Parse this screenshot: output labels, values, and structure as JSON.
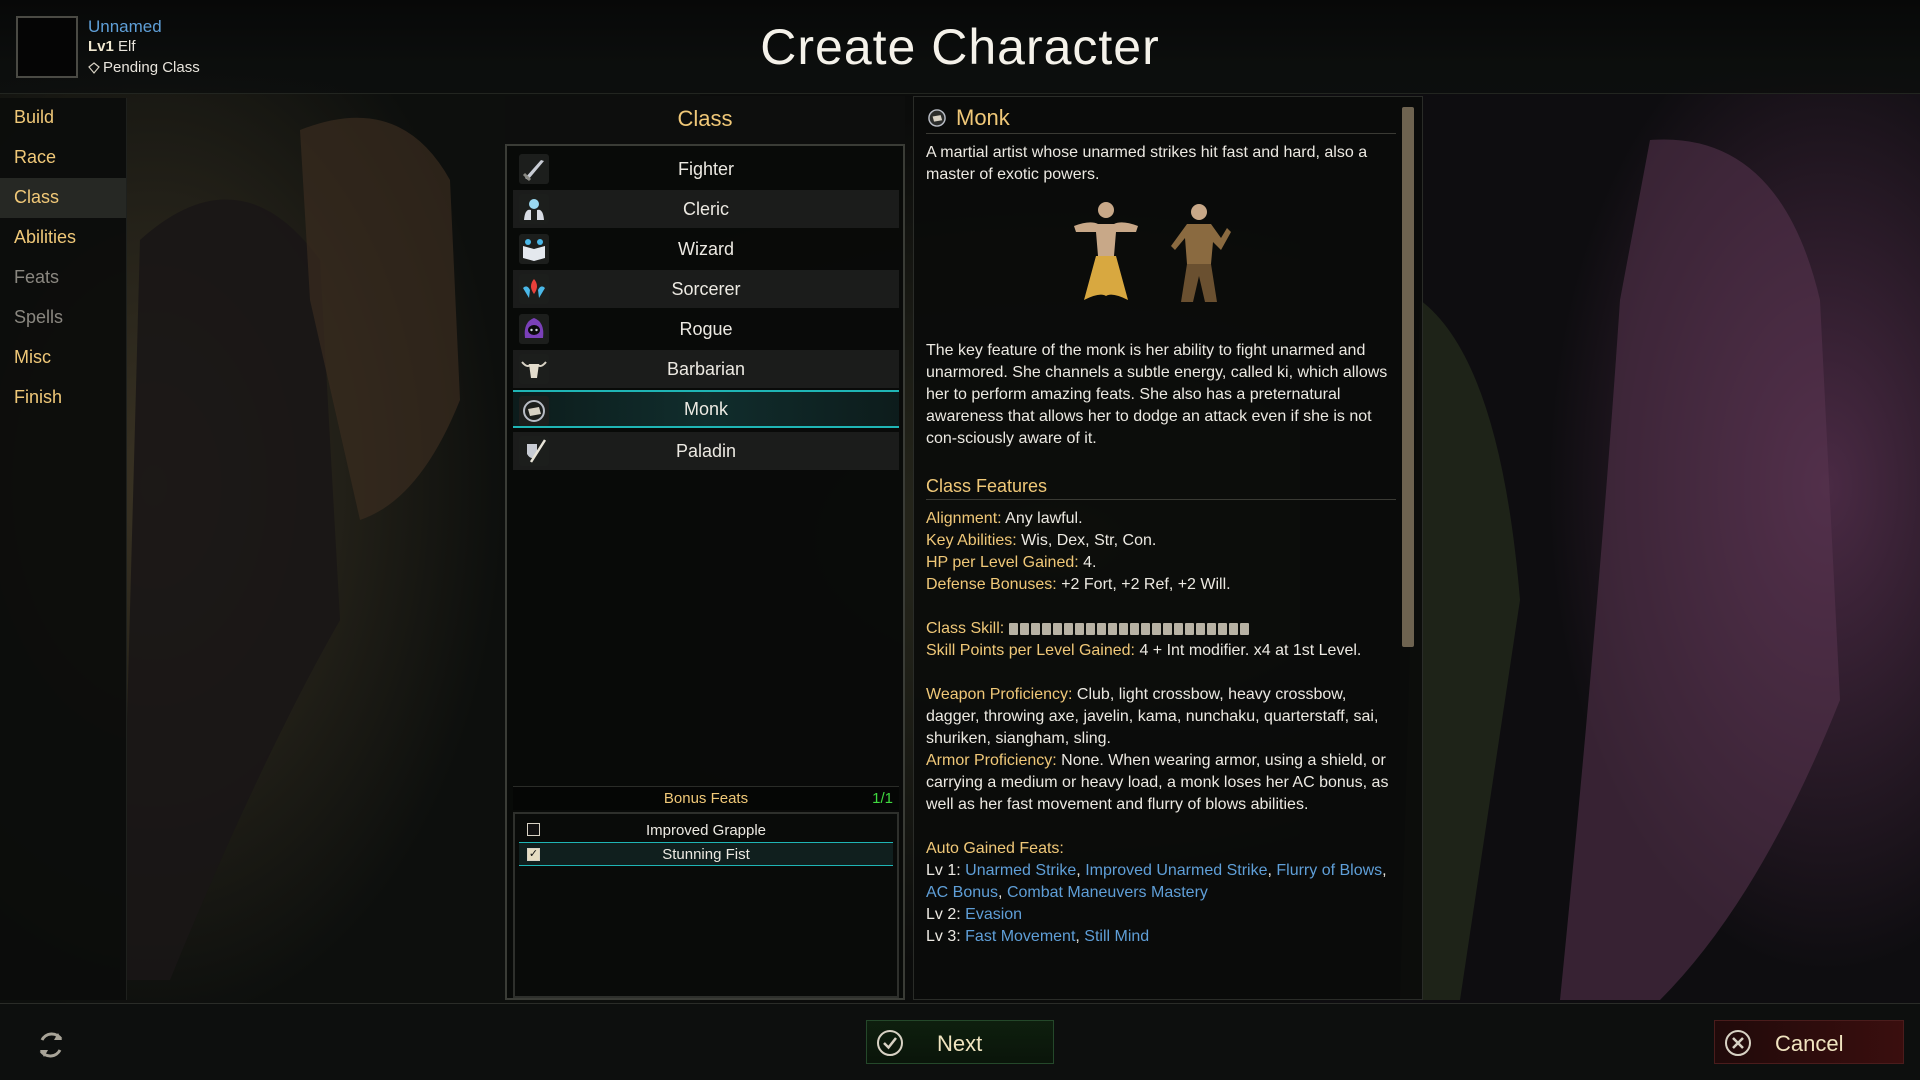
{
  "window": {
    "title": "Create Character"
  },
  "character": {
    "name": "Unnamed",
    "level_prefix": "Lv1",
    "race": "Elf",
    "class_status": "Pending Class"
  },
  "sidebar": {
    "items": [
      {
        "label": "Build",
        "state": "normal"
      },
      {
        "label": "Race",
        "state": "normal"
      },
      {
        "label": "Class",
        "state": "active"
      },
      {
        "label": "Abilities",
        "state": "normal"
      },
      {
        "label": "Feats",
        "state": "disabled"
      },
      {
        "label": "Spells",
        "state": "disabled"
      },
      {
        "label": "Misc",
        "state": "normal"
      },
      {
        "label": "Finish",
        "state": "normal"
      }
    ]
  },
  "class_panel": {
    "title": "Class",
    "classes": [
      {
        "label": "Fighter",
        "icon": "sword-icon"
      },
      {
        "label": "Cleric",
        "icon": "holy-hands-icon"
      },
      {
        "label": "Wizard",
        "icon": "spellbook-icon"
      },
      {
        "label": "Sorcerer",
        "icon": "flame-hands-icon"
      },
      {
        "label": "Rogue",
        "icon": "hood-icon"
      },
      {
        "label": "Barbarian",
        "icon": "bull-skull-icon"
      },
      {
        "label": "Monk",
        "icon": "fist-icon",
        "selected": true
      },
      {
        "label": "Paladin",
        "icon": "shield-sword-icon"
      }
    ],
    "bonus_feats": {
      "title": "Bonus Feats",
      "count": "1/1",
      "items": [
        {
          "label": "Improved Grapple",
          "checked": false
        },
        {
          "label": "Stunning Fist",
          "checked": true
        }
      ]
    }
  },
  "description": {
    "title": "Monk",
    "summary": "A martial artist whose unarmed strikes hit fast and hard, also a master of exotic powers.",
    "body": "The key feature of the monk is her ability to fight unarmed and unarmored. She channels a subtle energy, called ki, which allows her to perform amazing feats. She also has a preternatural awareness that allows her to dodge an attack  even if she is not con-sciously aware of it.",
    "features_title": "Class Features",
    "alignment_key": "Alignment:",
    "alignment_val": "Any lawful.",
    "key_abilities_key": "Key Abilities:",
    "key_abilities_val": "Wis, Dex, Str, Con.",
    "hp_key": "HP per Level Gained:",
    "hp_val": "4.",
    "defense_key": "Defense Bonuses:",
    "defense_val": "+2 Fort, +2 Ref, +2 Will.",
    "class_skill_key": "Class Skill:",
    "skill_points_key": "Skill Points per Level Gained:",
    "skill_points_val": "4 + Int modifier. x4 at 1st Level.",
    "weapon_key": "Weapon Proficiency:",
    "weapon_val": "Club, light crossbow, heavy crossbow,  dagger, throwing axe, javelin, kama, nunchaku, quarterstaff, sai, shuriken, siangham, sling.",
    "armor_key": "Armor Proficiency:",
    "armor_val": "None. When wearing armor, using a shield, or carrying a medium or heavy load, a monk loses her AC bonus, as well as her fast movement and flurry of blows abilities.",
    "auto_feats_title": "Auto Gained Feats:",
    "lv1_prefix": "Lv 1:",
    "lv1_feats": [
      "Unarmed Strike",
      "Improved Unarmed Strike",
      "Flurry of Blows",
      "AC Bonus",
      "Combat Maneuvers Mastery"
    ],
    "lv2_prefix": "Lv 2:",
    "lv2_feats": [
      "Evasion"
    ],
    "lv3_prefix": "Lv 3:",
    "lv3_feats": [
      "Fast Movement",
      "Still Mind"
    ]
  },
  "footer": {
    "next_label": "Next",
    "cancel_label": "Cancel"
  },
  "colors": {
    "accent_gold": "#f0c878",
    "link_blue": "#5f9fd8",
    "selection_teal": "#1fb5b5",
    "count_green": "#3fd83f"
  }
}
